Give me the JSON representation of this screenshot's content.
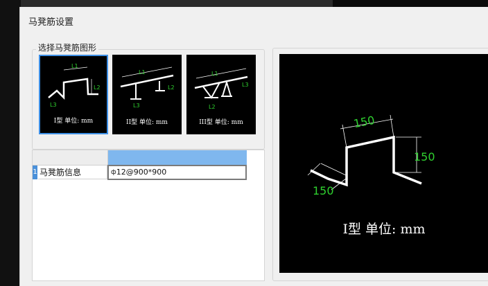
{
  "dialog": {
    "title": "马凳筋设置"
  },
  "shape_group": {
    "legend": "选择马凳筋图形",
    "options": [
      {
        "caption": "I型 单位: mm",
        "selected": true,
        "labels": [
          "L1",
          "L2",
          "L3"
        ]
      },
      {
        "caption": "II型 单位: mm",
        "selected": false,
        "labels": [
          "L1",
          "L2",
          "L3"
        ]
      },
      {
        "caption": "III型 单位: mm",
        "selected": false,
        "labels": [
          "L1",
          "L2",
          "L3"
        ]
      }
    ]
  },
  "table": {
    "rows": [
      {
        "index": "1",
        "name": "马凳筋信息",
        "value": "12@900*900",
        "symbol": "ф"
      }
    ]
  },
  "preview": {
    "caption": "I型  单位: mm",
    "dims": {
      "L1": "150",
      "L2": "150",
      "L3": "150"
    }
  },
  "colors": {
    "dimension": "#2fd12f",
    "selection": "#3d8fe6",
    "header_selected": "#7fb7ee"
  }
}
